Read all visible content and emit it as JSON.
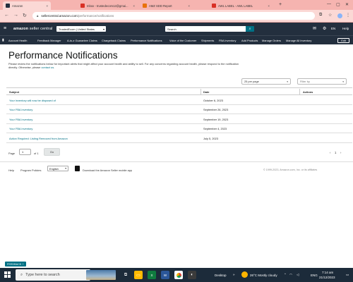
{
  "browser": {
    "tabs": [
      {
        "title": "Amazon",
        "active": true,
        "color": "#232f3e"
      },
      {
        "title": "Inbox - trustedecom12@gmai...",
        "active": false,
        "color": "#d93025"
      },
      {
        "title": "AMZ SDD Report",
        "active": false,
        "color": "#e8710a"
      },
      {
        "title": "AWL LABEL - AWL LABEL",
        "active": false,
        "color": "#d93025"
      }
    ],
    "url_host": "sellercentral.amazon.com",
    "url_path": "/performance/notifications"
  },
  "header": {
    "logo_main": "amazon",
    "logo_sub": "seller central",
    "marketplace": "TrustedEcom | United States",
    "search_placeholder": "Search",
    "language": "EN",
    "help": "Help"
  },
  "nav": {
    "items": [
      "Account Health",
      "Feedback Manager",
      "A-to-z Guarantee Claims",
      "Chargeback Claims",
      "Performance Notifications",
      "Voice of the Customer",
      "Shipments",
      "FBA Inventory",
      "Add Products",
      "Manage Orders",
      "Manage All Inventory"
    ],
    "edit": "Edit"
  },
  "page": {
    "title": "Performance Notifications",
    "description": "Please review the notifications below for important alerts that might affect your account health and ability to sell. For any concerns regarding account health, please respond to the notification directly. Otherwise, please",
    "contact_link": "contact us",
    "per_page": "25 per page",
    "filter_by": "Filter by"
  },
  "table": {
    "headers": [
      "Subject",
      "Date",
      "Actions"
    ],
    "rows": [
      {
        "subject": "Your inventory will now be disposed of",
        "date": "October 6, 2023"
      },
      {
        "subject": "Your FBA Inventory",
        "date": "September 26, 2023"
      },
      {
        "subject": "Your FBA Inventory",
        "date": "September 19, 2023"
      },
      {
        "subject": "Your FBA Inventory",
        "date": "September 4, 2023"
      },
      {
        "subject": "Action Required: Listing Removed from Amazon",
        "date": "July 5, 2023"
      }
    ]
  },
  "pagination": {
    "page_label": "Page",
    "page_value": "1",
    "of_label": "of 1",
    "go": "Go",
    "current": "1"
  },
  "footer": {
    "help": "Help",
    "program_policies": "Program Policies",
    "language": "English",
    "app_text": "Download the Amazon Seller mobile app",
    "copyright": "© 1999-2023, Amazon.com, Inc. or its affiliates"
  },
  "feedback": "FEEDBACK",
  "taskbar": {
    "search_placeholder": "Type here to search",
    "desktop": "Desktop",
    "weather": "26°C  Mostly cloudy",
    "lang": "ENG",
    "time": "7:14 am",
    "date": "21/12/2023"
  },
  "colors": {
    "header_bg": "#232f3e",
    "link": "#007185",
    "tab_strip": "#f6b4b0"
  }
}
